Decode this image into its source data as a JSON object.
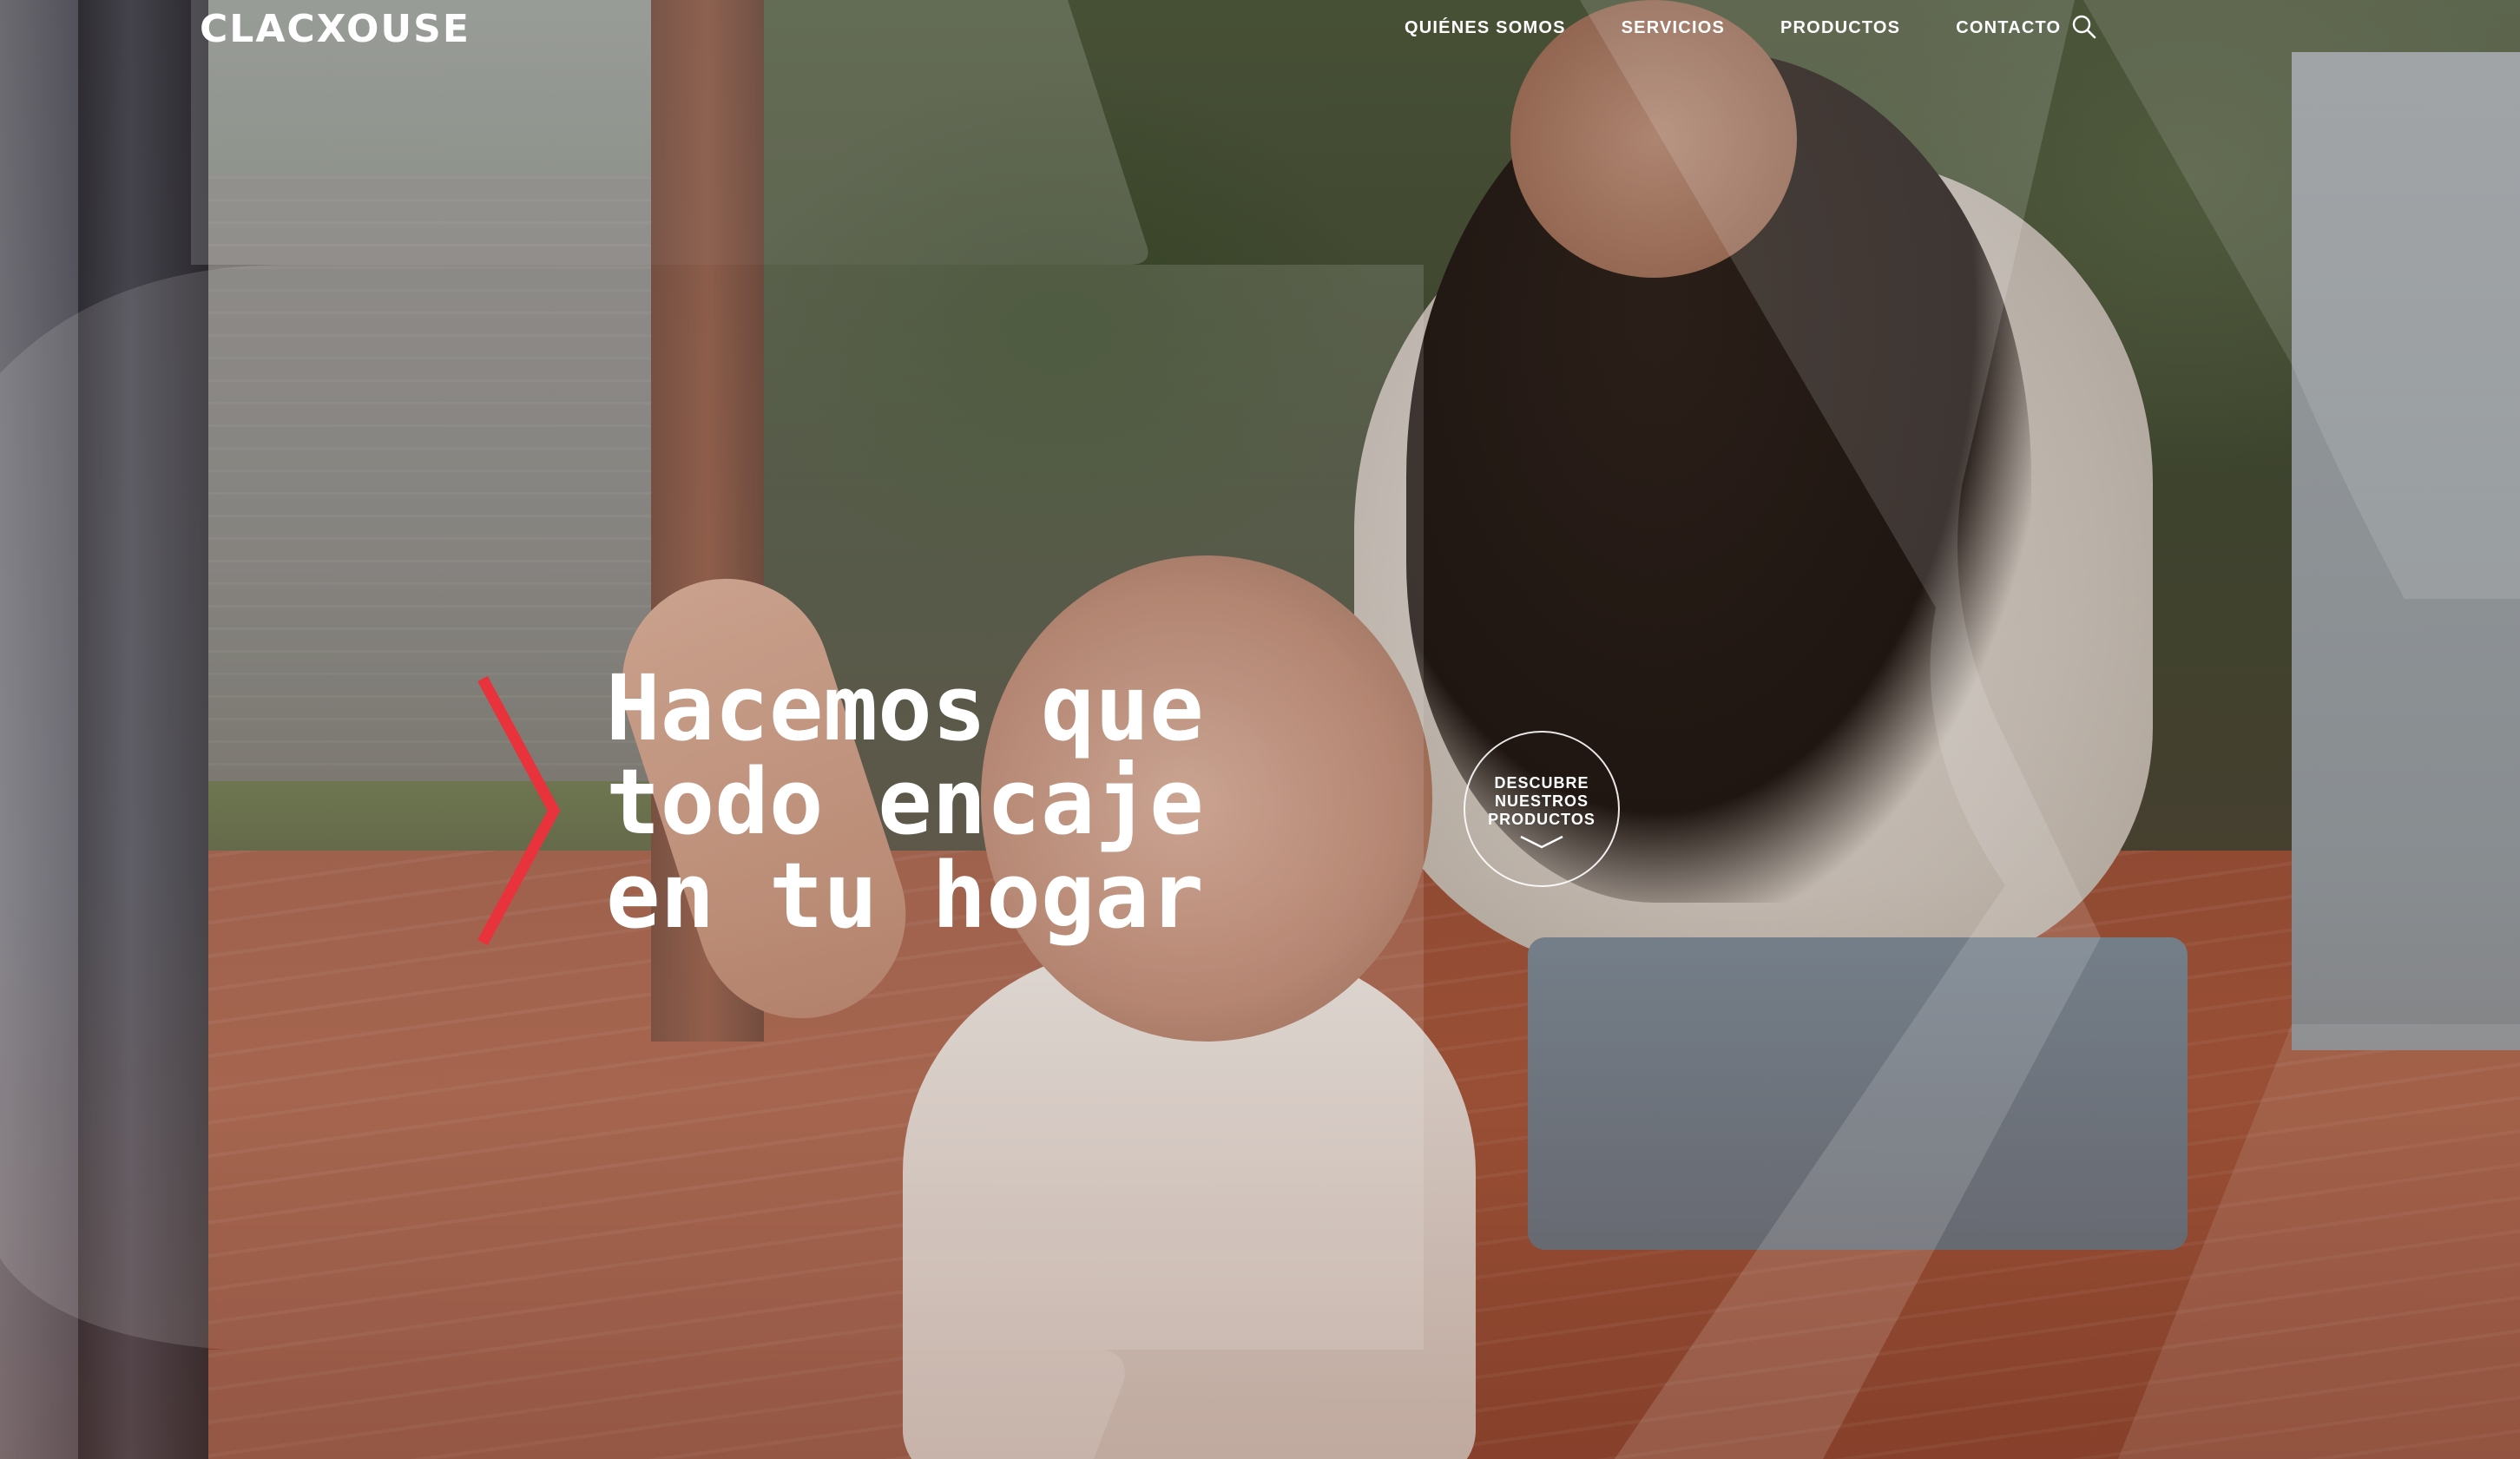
{
  "brand": {
    "logo_text": "CLACXOUSE"
  },
  "nav": {
    "items": [
      {
        "label": "QUIÉNES SOMOS"
      },
      {
        "label": "SERVICIOS"
      },
      {
        "label": "PRODUCTOS"
      },
      {
        "label": "CONTACTO"
      }
    ],
    "search_icon": "search-icon"
  },
  "hero": {
    "headline_lines": [
      "Hacemos que",
      "todo encaje",
      "en tu hogar"
    ],
    "chevron_icon": "chevron-right-icon",
    "chevron_color": "#e8323c",
    "cta": {
      "lines": [
        "DESCUBRE",
        "NUESTROS",
        "PRODUCTOS"
      ],
      "icon": "chevron-down-icon"
    }
  }
}
